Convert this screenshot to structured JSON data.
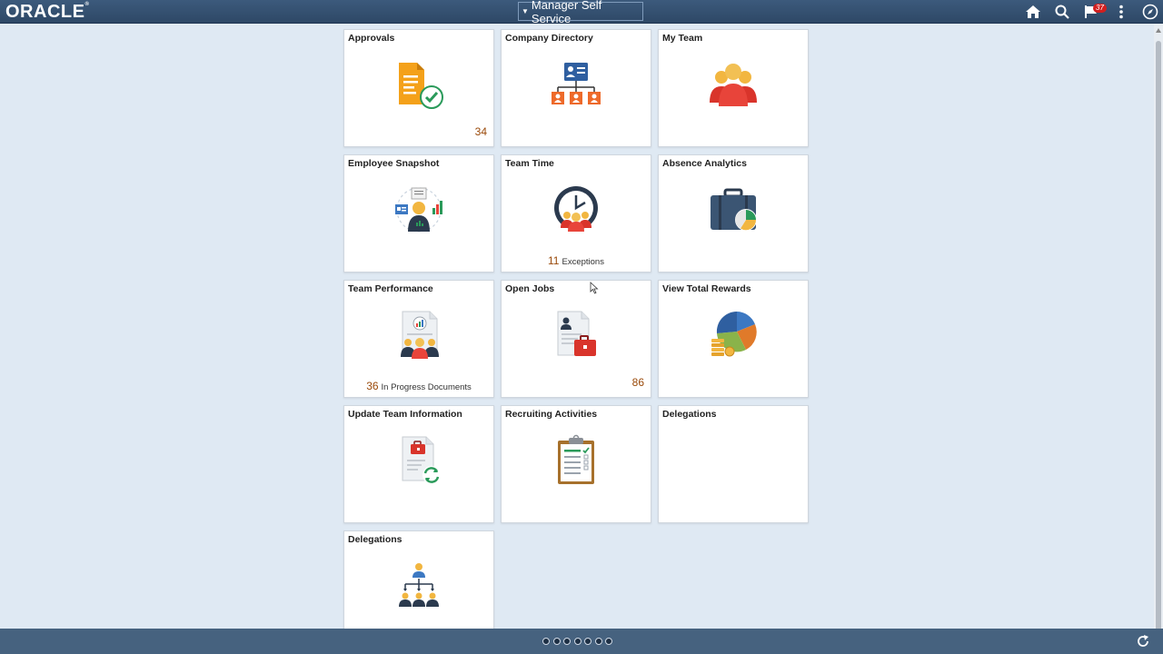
{
  "header": {
    "logo": "ORACLE",
    "homepage": "Manager Self Service",
    "notification_count": "37",
    "icons": [
      "home-icon",
      "search-icon",
      "notification-flag-icon",
      "actions-menu-icon",
      "navbar-compass-icon"
    ]
  },
  "tiles": [
    {
      "title": "Approvals",
      "icon": "approvals-document-check-icon",
      "count": "34"
    },
    {
      "title": "Company Directory",
      "icon": "company-directory-org-icon"
    },
    {
      "title": "My Team",
      "icon": "my-team-people-icon"
    },
    {
      "title": "Employee Snapshot",
      "icon": "employee-snapshot-icon"
    },
    {
      "title": "Team Time",
      "icon": "team-time-clock-icon",
      "caption_num": "11",
      "caption_text": "Exceptions"
    },
    {
      "title": "Absence Analytics",
      "icon": "absence-analytics-briefcase-icon"
    },
    {
      "title": "Team Performance",
      "icon": "team-performance-icon",
      "caption_num": "36",
      "caption_text": "In Progress Documents"
    },
    {
      "title": "Open Jobs",
      "icon": "open-jobs-icon",
      "count": "86"
    },
    {
      "title": "View Total Rewards",
      "icon": "total-rewards-pie-icon"
    },
    {
      "title": "Update Team Information",
      "icon": "update-team-info-icon"
    },
    {
      "title": "Recruiting Activities",
      "icon": "recruiting-clipboard-icon"
    },
    {
      "title": "Delegations",
      "icon": ""
    },
    {
      "title": "Delegations",
      "icon": "delegations-hierarchy-icon"
    }
  ],
  "footer": {
    "page_dots": 7,
    "icons": [
      "refresh-icon"
    ]
  },
  "colors": {
    "header_bg": "#2e4866",
    "page_bg": "#dfe9f3",
    "count_color": "#9a4a0a",
    "footer_bg": "#46627f"
  }
}
